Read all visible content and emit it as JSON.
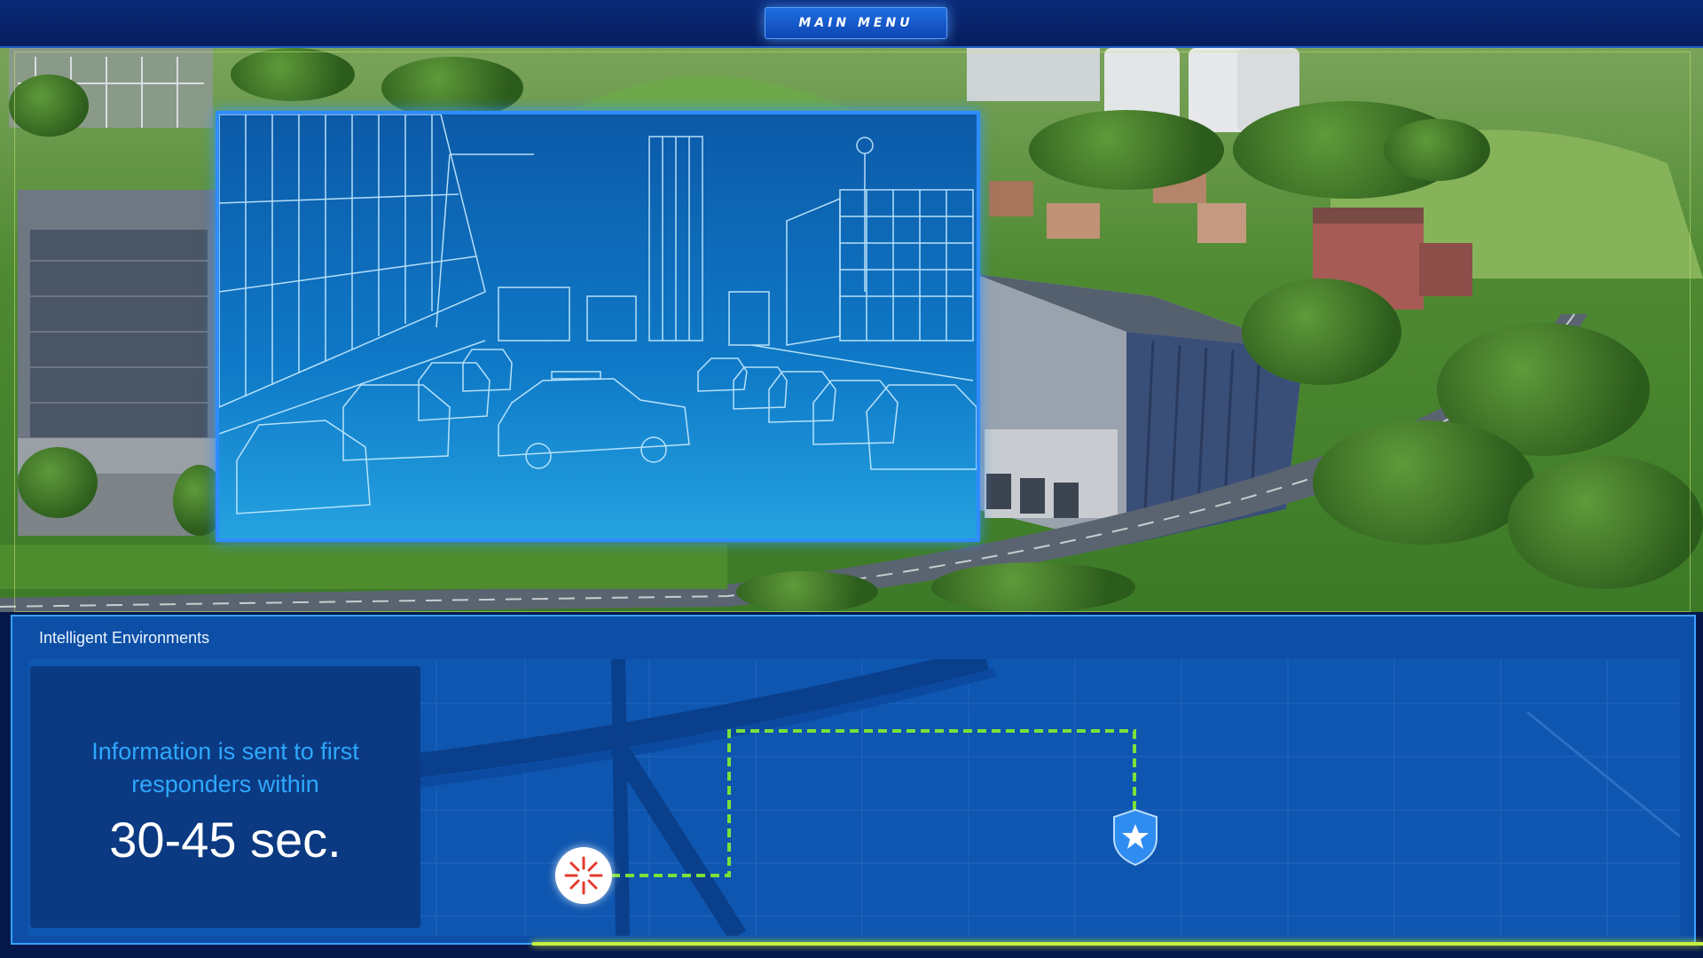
{
  "header": {
    "menu_label": "MAIN MENU"
  },
  "info_panel": {
    "title": "Intelligent Environments",
    "message": "Information is sent to first responders within",
    "value": "30-45 sec."
  },
  "icons": {
    "incident": "incident-burst-icon",
    "responder": "police-shield-icon"
  },
  "colors": {
    "route": "#7be03a",
    "panel": "#0d4fa6",
    "accent": "#2fa8ff"
  }
}
